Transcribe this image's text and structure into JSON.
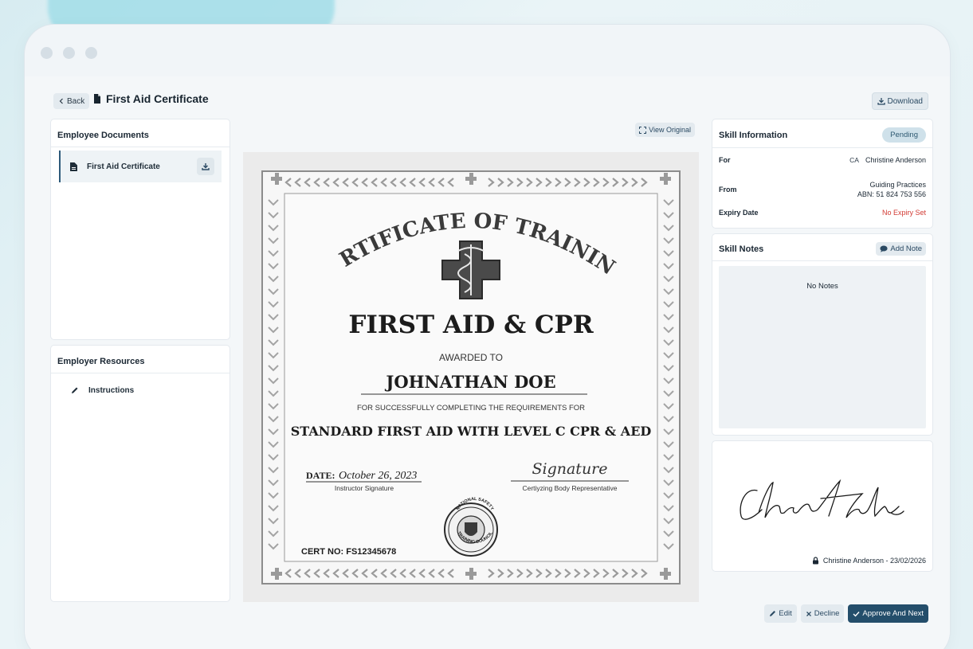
{
  "header": {
    "back_label": "Back",
    "title": "First Aid Certificate",
    "download_label": "Download"
  },
  "employee_documents": {
    "title": "Employee Documents",
    "items": [
      {
        "label": "First Aid Certificate",
        "icon": "file-icon"
      }
    ]
  },
  "employer_resources": {
    "title": "Employer Resources",
    "items": [
      {
        "label": "Instructions",
        "icon": "pencil-icon"
      }
    ]
  },
  "viewer": {
    "view_original_label": "View Original",
    "certificate": {
      "arc_title": "CERTIFICATE OF TRAINING",
      "main_title": "FIRST AID & CPR",
      "awarded_to": "AWARDED TO",
      "recipient": "JOHNATHAN DOE",
      "requirement_text": "FOR SUCCESSFULLY COMPLETING THE REQUIREMENTS FOR",
      "course": "STANDARD FIRST AID WITH LEVEL C CPR & AED",
      "date_label": "DATE:",
      "date_value": "October 26, 2023",
      "instructor_label": "Instructor Signature",
      "signature_text": "Signature",
      "body_rep_label": "Certiyzing Body Representative",
      "cert_no": "CERT NO: FS12345678",
      "seal_text_top": "NATIONAL SAFETY",
      "seal_text_bottom": "TRAINING COUNCIL"
    }
  },
  "skill_info": {
    "title": "Skill Information",
    "status": "Pending",
    "for_label": "For",
    "for_initials": "CA",
    "for_name": "Christine Anderson",
    "from_label": "From",
    "from_org": "Guiding Practices",
    "from_abn": "ABN: 51 824 753 556",
    "expiry_label": "Expiry Date",
    "expiry_value": "No Expiry Set"
  },
  "skill_notes": {
    "title": "Skill Notes",
    "add_label": "Add Note",
    "empty_text": "No Notes"
  },
  "signature": {
    "signed_by": "Christine Anderson - 23/02/2026"
  },
  "actions": {
    "edit_label": "Edit",
    "decline_label": "Decline",
    "approve_label": "Approve And Next"
  },
  "colors": {
    "primary": "#244e6b",
    "pending_bg": "#cfe1ea",
    "danger": "#d23b34"
  }
}
